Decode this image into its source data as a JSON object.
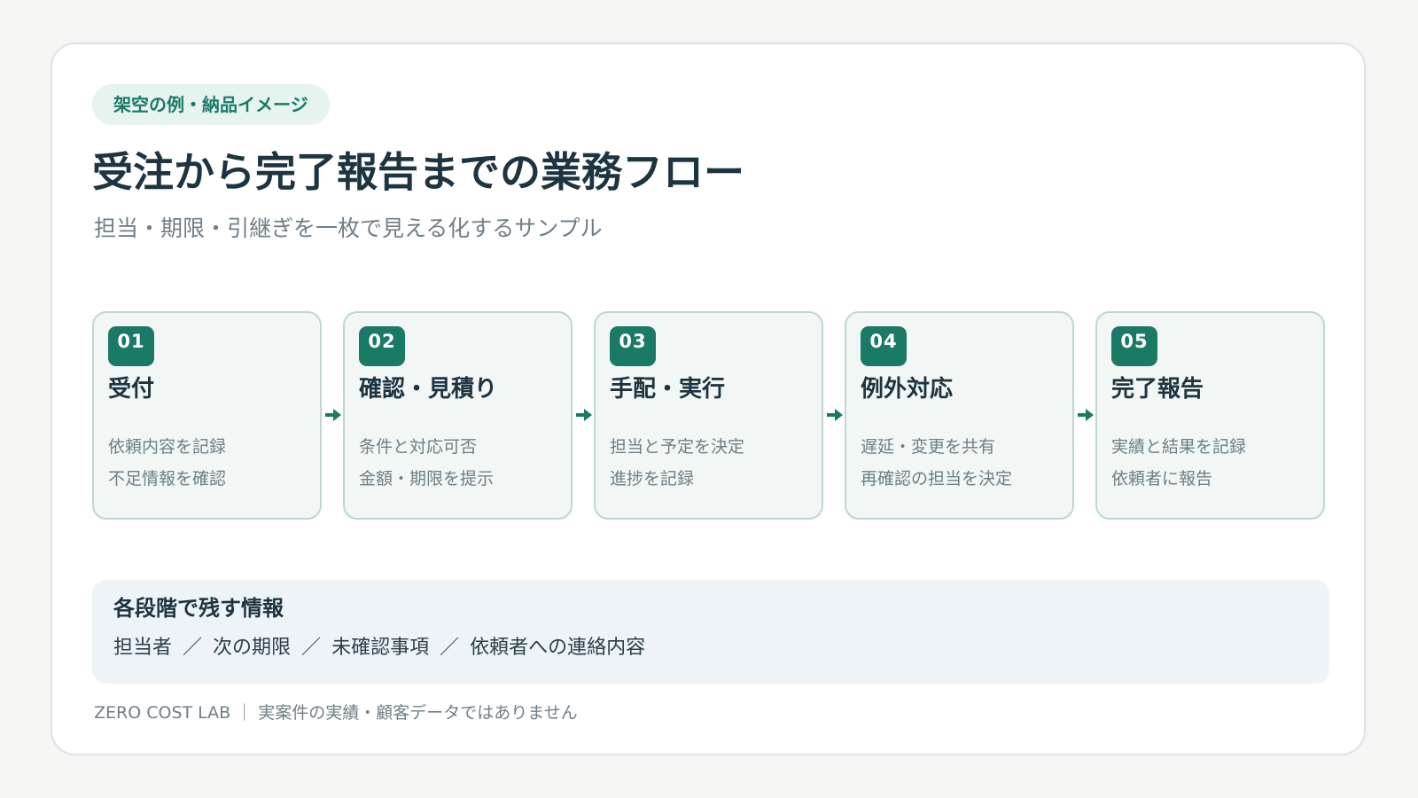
{
  "tag": "架空の例・納品イメージ",
  "title": "受注から完了報告までの業務フロー",
  "subtitle": "担当・期限・引継ぎを一枚で見える化するサンプル",
  "steps": [
    {
      "num": "01",
      "title": "受付",
      "lines": [
        "依頼内容を記録",
        "不足情報を確認"
      ]
    },
    {
      "num": "02",
      "title": "確認・見積り",
      "lines": [
        "条件と対応可否",
        "金額・期限を提示"
      ]
    },
    {
      "num": "03",
      "title": "手配・実行",
      "lines": [
        "担当と予定を決定",
        "進捗を記録"
      ]
    },
    {
      "num": "04",
      "title": "例外対応",
      "lines": [
        "遅延・変更を共有",
        "再確認の担当を決定"
      ]
    },
    {
      "num": "05",
      "title": "完了報告",
      "lines": [
        "実績と結果を記録",
        "依頼者に報告"
      ]
    }
  ],
  "info": {
    "title": "各段階で残す情報",
    "items": [
      "担当者",
      "次の期限",
      "未確認事項",
      "依頼者への連絡内容"
    ],
    "separator": "／"
  },
  "footer": "ZERO COST LAB ｜ 実案件の実績・顧客データではありません",
  "colors": {
    "accent": "#1b7a66",
    "title": "#1e3441",
    "muted": "#6e7f87",
    "step_bg": "#f2f6f5",
    "step_border": "#bcd9d0",
    "info_bg": "#edf3f6"
  }
}
